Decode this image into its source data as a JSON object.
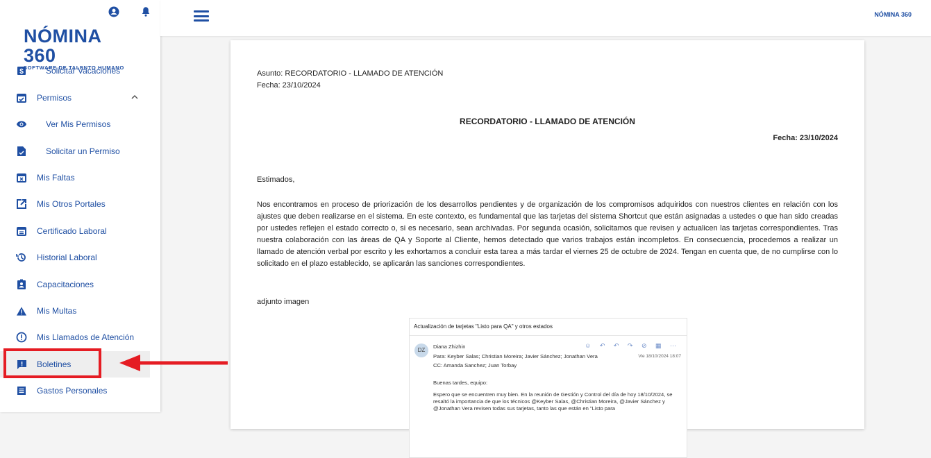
{
  "sidebar": {
    "logo": {
      "main": "NÓMINA 360",
      "sub": "SOFTWARE DE TALENTO HUMANO"
    },
    "items": [
      {
        "label": "Solicitar Vacaciones",
        "icon": "dollar-doc-icon"
      },
      {
        "label": "Permisos",
        "icon": "calendar-check-icon"
      },
      {
        "label": "Ver Mis Permisos",
        "icon": "eye-icon"
      },
      {
        "label": "Solicitar un Permiso",
        "icon": "file-check-icon"
      },
      {
        "label": "Mis Faltas",
        "icon": "calendar-x-icon"
      },
      {
        "label": "Mis Otros Portales",
        "icon": "external-link-icon"
      },
      {
        "label": "Certificado Laboral",
        "icon": "calendar-lines-icon"
      },
      {
        "label": "Historial Laboral",
        "icon": "history-icon"
      },
      {
        "label": "Capacitaciones",
        "icon": "badge-icon"
      },
      {
        "label": "Mis Multas",
        "icon": "warning-icon"
      },
      {
        "label": "Mis Llamados de Atención",
        "icon": "alert-circle-icon"
      },
      {
        "label": "Boletines",
        "icon": "announcement-icon"
      },
      {
        "label": "Gastos Personales",
        "icon": "list-doc-icon"
      }
    ]
  },
  "topbar": {
    "brand": "NÓMINA 360"
  },
  "document": {
    "asunto": "Asunto: RECORDATORIO - LLAMADO DE ATENCIÓN",
    "fecha": "Fecha: 23/10/2024",
    "title": "RECORDATORIO - LLAMADO DE ATENCIÓN",
    "fecha_right": "Fecha: 23/10/2024",
    "saludo": "Estimados,",
    "body": "Nos encontramos en proceso de priorización de los desarrollos pendientes y de organización de los compromisos adquiridos con nuestros clientes en relación con los ajustes que deben realizarse en el sistema. En este contexto, es fundamental que las tarjetas del sistema Shortcut que están asignadas a ustedes o que han sido creadas por ustedes reflejen el estado correcto o, si es necesario, sean archivadas. Por segunda ocasión, solicitamos que revisen y actualicen las tarjetas correspondientes. Tras nuestra colaboración con las áreas de QA y Soporte al Cliente, hemos detectado que varios trabajos están incompletos. En consecuencia, procedemos a realizar un llamado de atención verbal por escrito y les exhortamos a concluir esta tarea a más tardar el viernes 25 de octubre de 2024. Tengan en cuenta que, de no cumplirse con lo solicitado en el plazo establecido, se aplicarán las sanciones correspondientes.",
    "adjunto": "adjunto imagen"
  },
  "email": {
    "subject": "Actualización de tarjetas \"Listo para QA\"  y otros estados",
    "avatar": "DZ",
    "sender": "Diana Zhizhin",
    "to": "Para:  Keyber Salas;   Christian Moreira;   Javier Sánchez;   Jonathan Vera",
    "cc": "CC:   Amanda Sanchez;   Juan Torbay",
    "date": "Vie 18/10/2024 18:07",
    "greeting": "Buenas tardes, equipo:",
    "paragraph": "Espero que se encuentren muy bien. En la reunión de Gestión y Control del día de hoy 18/10/2024, se resaltó la importancia de que los técnicos @Keyber Salas, @Christian Moreira, @Javier Sánchez y @Jonathan Vera revisen todas sus tarjetas, tanto las que están en \"Listo para"
  },
  "colors": {
    "accent": "#1f4fa3",
    "highlight": "#e51c23"
  }
}
